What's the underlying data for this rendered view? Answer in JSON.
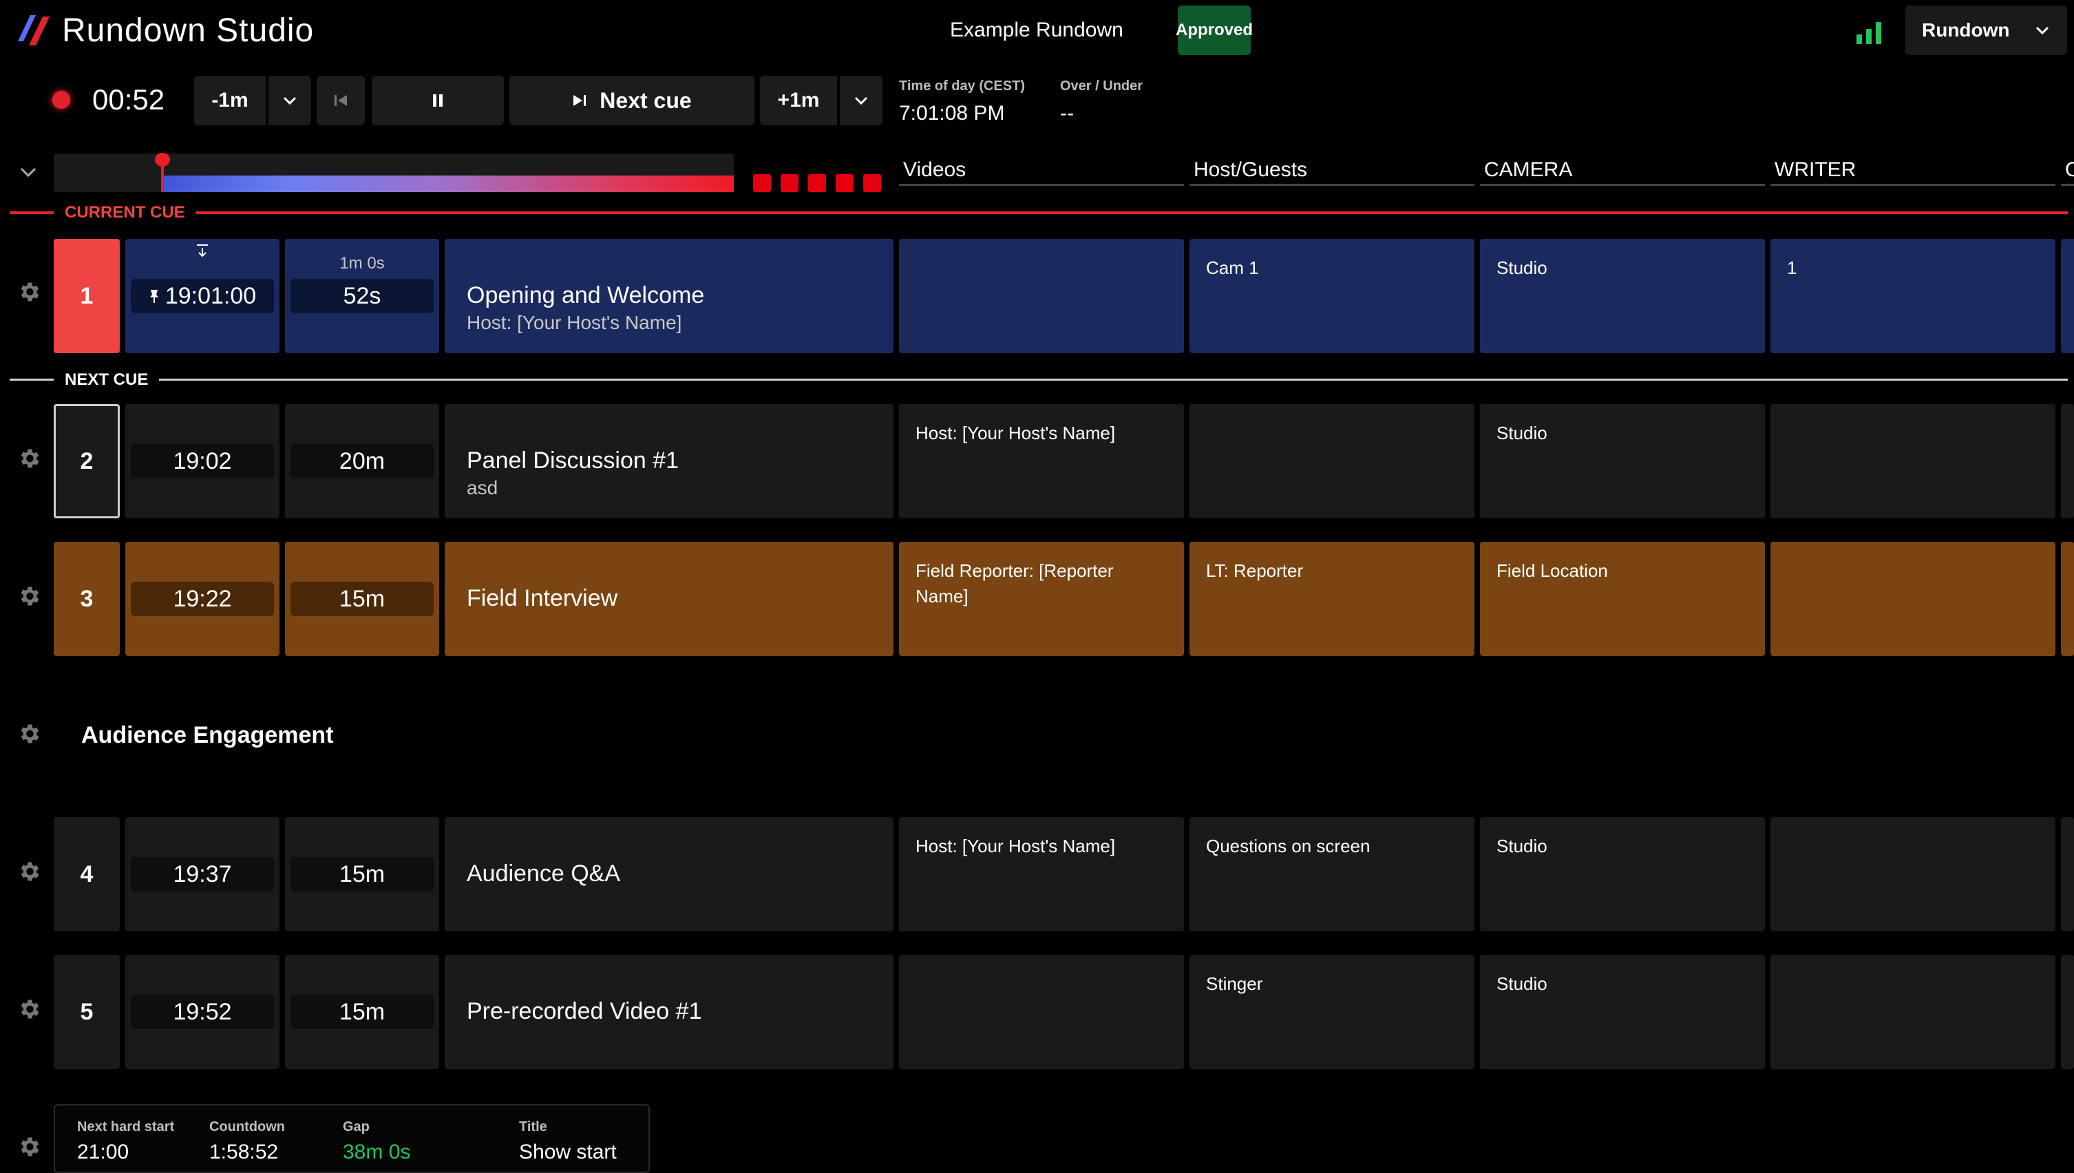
{
  "header": {
    "app_title": "Rundown Studio",
    "rundown_name": "Example Rundown",
    "status_badge": "Approved",
    "view_select": "Rundown"
  },
  "transport": {
    "timer": "00:52",
    "minus_label": "-1m",
    "next_cue_label": "Next cue",
    "plus_label": "+1m",
    "time_of_day_label": "Time of day (CEST)",
    "time_of_day_value": "7:01:08 PM",
    "over_under_label": "Over / Under",
    "over_under_value": "--",
    "progress_fraction": 0.16
  },
  "columns": [
    "Videos",
    "Host/Guests",
    "CAMERA",
    "WRITER",
    "O"
  ],
  "dividers": {
    "current": "CURRENT CUE",
    "next": "NEXT CUE"
  },
  "cues": [
    {
      "number": "1",
      "start": "19:01:00",
      "duration_top": "1m 0s",
      "duration": "52s",
      "title": "Opening and Welcome",
      "subtitle": "Host: [Your Host's Name]",
      "cells": [
        "",
        "Cam 1",
        "Studio",
        "1"
      ]
    },
    {
      "number": "2",
      "start": "19:02",
      "duration": "20m",
      "title": "Panel Discussion #1",
      "subtitle": "asd",
      "cells": [
        "Host: [Your Host's Name]",
        "",
        "Studio",
        ""
      ]
    },
    {
      "number": "3",
      "start": "19:22",
      "duration": "15m",
      "title": "Field Interview",
      "subtitle": "",
      "cells": [
        "Field Reporter: [Reporter Name]",
        "LT: Reporter",
        "Field Location",
        ""
      ]
    },
    {
      "number": "4",
      "start": "19:37",
      "duration": "15m",
      "title": "Audience Q&A",
      "subtitle": "",
      "cells": [
        "Host: [Your Host's Name]",
        "Questions on screen",
        "Studio",
        ""
      ]
    },
    {
      "number": "5",
      "start": "19:52",
      "duration": "15m",
      "title": "Pre-recorded Video #1",
      "subtitle": "",
      "cells": [
        "",
        "Stinger",
        "Studio",
        ""
      ]
    }
  ],
  "heading": "Audience Engagement",
  "footer": {
    "next_hard_start_label": "Next hard start",
    "next_hard_start_value": "21:00",
    "countdown_label": "Countdown",
    "countdown_value": "1:58:52",
    "gap_label": "Gap",
    "gap_value": "38m 0s",
    "title_label": "Title",
    "title_value": "Show start"
  },
  "colors": {
    "current_row": "#1b2a5e",
    "current_number": "#ef4444",
    "default_row": "#1a1a1a",
    "field_row": "#7a4512",
    "accent_red": "#e3232a",
    "approved_bg": "#0f5a2c",
    "gap_green": "#22c55e",
    "signal_green": "#22c55e"
  }
}
